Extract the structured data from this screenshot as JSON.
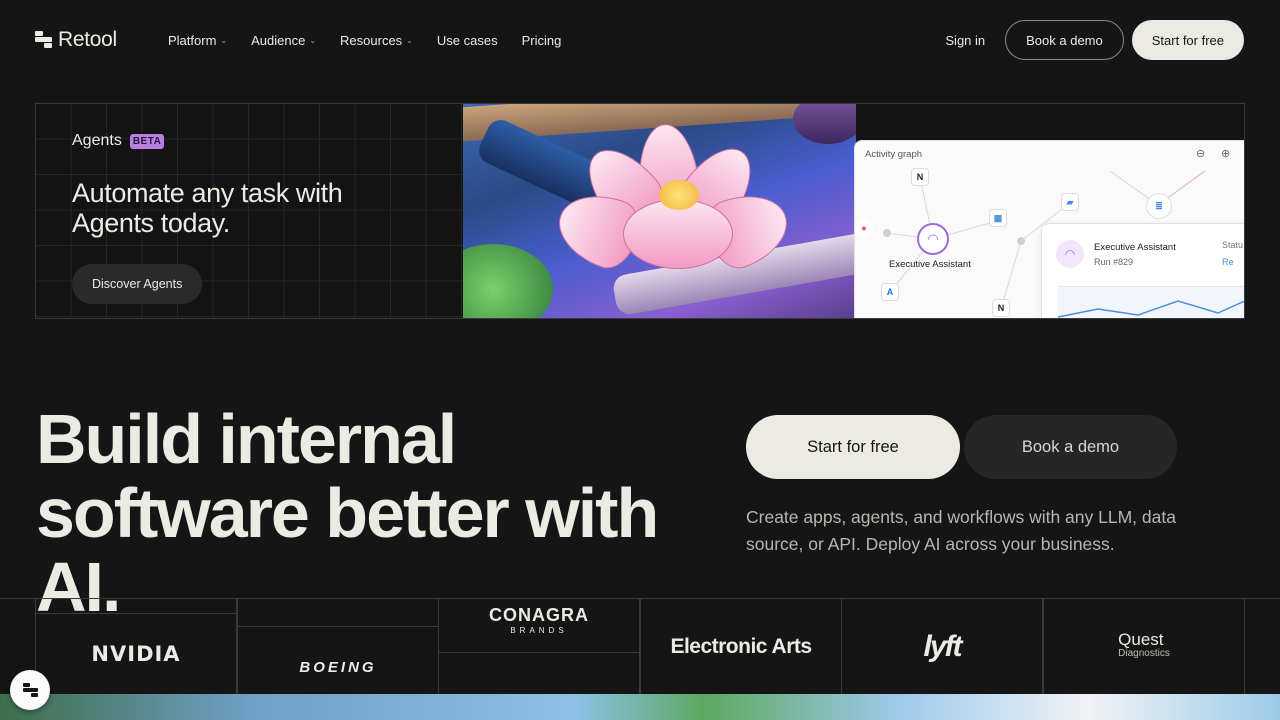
{
  "nav": {
    "brand": "Retool",
    "menu": [
      {
        "label": "Platform",
        "has_dropdown": true
      },
      {
        "label": "Audience",
        "has_dropdown": true
      },
      {
        "label": "Resources",
        "has_dropdown": true
      },
      {
        "label": "Use cases",
        "has_dropdown": false
      },
      {
        "label": "Pricing",
        "has_dropdown": false
      }
    ],
    "sign_in": "Sign in",
    "book_demo": "Book a demo",
    "start_free": "Start for free"
  },
  "banner": {
    "label": "Agents",
    "badge": "BETA",
    "title": "Automate any task with Agents today.",
    "cta": "Discover Agents",
    "graph": {
      "title": "Activity graph",
      "node_label": "Executive Assistant",
      "card_title": "Executive Assistant",
      "card_run": "Run #829",
      "card_status_label": "Statu",
      "card_status_value": "Re"
    }
  },
  "hero": {
    "title": "Build internal software better with AI.",
    "primary_cta": "Start for free",
    "secondary_cta": "Book a demo",
    "description": "Create apps, agents, and workflows with any LLM, data source, or API. Deploy AI across your business."
  },
  "logos": {
    "nvidia": "NVIDIA",
    "boeing": "BOEING",
    "conagra": "CONAGRA",
    "conagra_sub": "BRANDS",
    "ea": "Electronic Arts",
    "lyft": "lyft",
    "quest": "Quest",
    "quest_sub": "Diagnostics"
  },
  "icons": {
    "brand": "retool-logo-icon",
    "chevron": "chevron-down-icon",
    "zoom_out": "zoom-out-icon",
    "zoom_in": "zoom-in-icon",
    "headset": "headset-icon"
  },
  "colors": {
    "background": "#151515",
    "text": "#ecebe3",
    "accent_beta": "#b77fe0",
    "button_light": "#ecebe3",
    "button_dark": "#262626"
  }
}
